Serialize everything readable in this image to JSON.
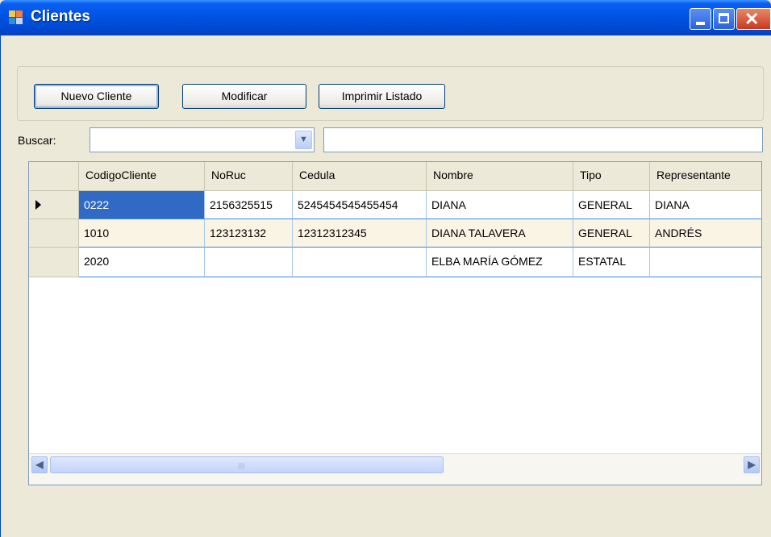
{
  "window": {
    "title": "Clientes",
    "icon": "form-icon",
    "controls": {
      "minimize": "minimize-icon",
      "maximize": "maximize-icon",
      "close": "✕"
    }
  },
  "toolbar": {
    "new_label": "Nuevo Cliente",
    "edit_label": "Modificar",
    "print_label": "Imprimir Listado"
  },
  "search": {
    "label": "Buscar:",
    "combo_value": "",
    "text_value": ""
  },
  "grid": {
    "columns": [
      "CodigoCliente",
      "NoRuc",
      "Cedula",
      "Nombre",
      "Tipo",
      "Representante"
    ],
    "rows": [
      [
        "0222",
        "2156325515",
        "5245454545455454",
        "DIANA",
        "GENERAL",
        "DIANA"
      ],
      [
        "1010",
        "123123132",
        "12312312345",
        "DIANA TALAVERA",
        "GENERAL",
        "ANDRÉS"
      ],
      [
        "2020",
        "",
        "",
        "ELBA MARÍA GÓMEZ",
        "ESTATAL",
        ""
      ]
    ],
    "current_row": 0,
    "selection_color": "#316ac5",
    "alt_row_color": "#faf4e4"
  },
  "colors": {
    "titlebar": "#0054e3",
    "face": "#ece9d8",
    "close": "#c8391b"
  }
}
